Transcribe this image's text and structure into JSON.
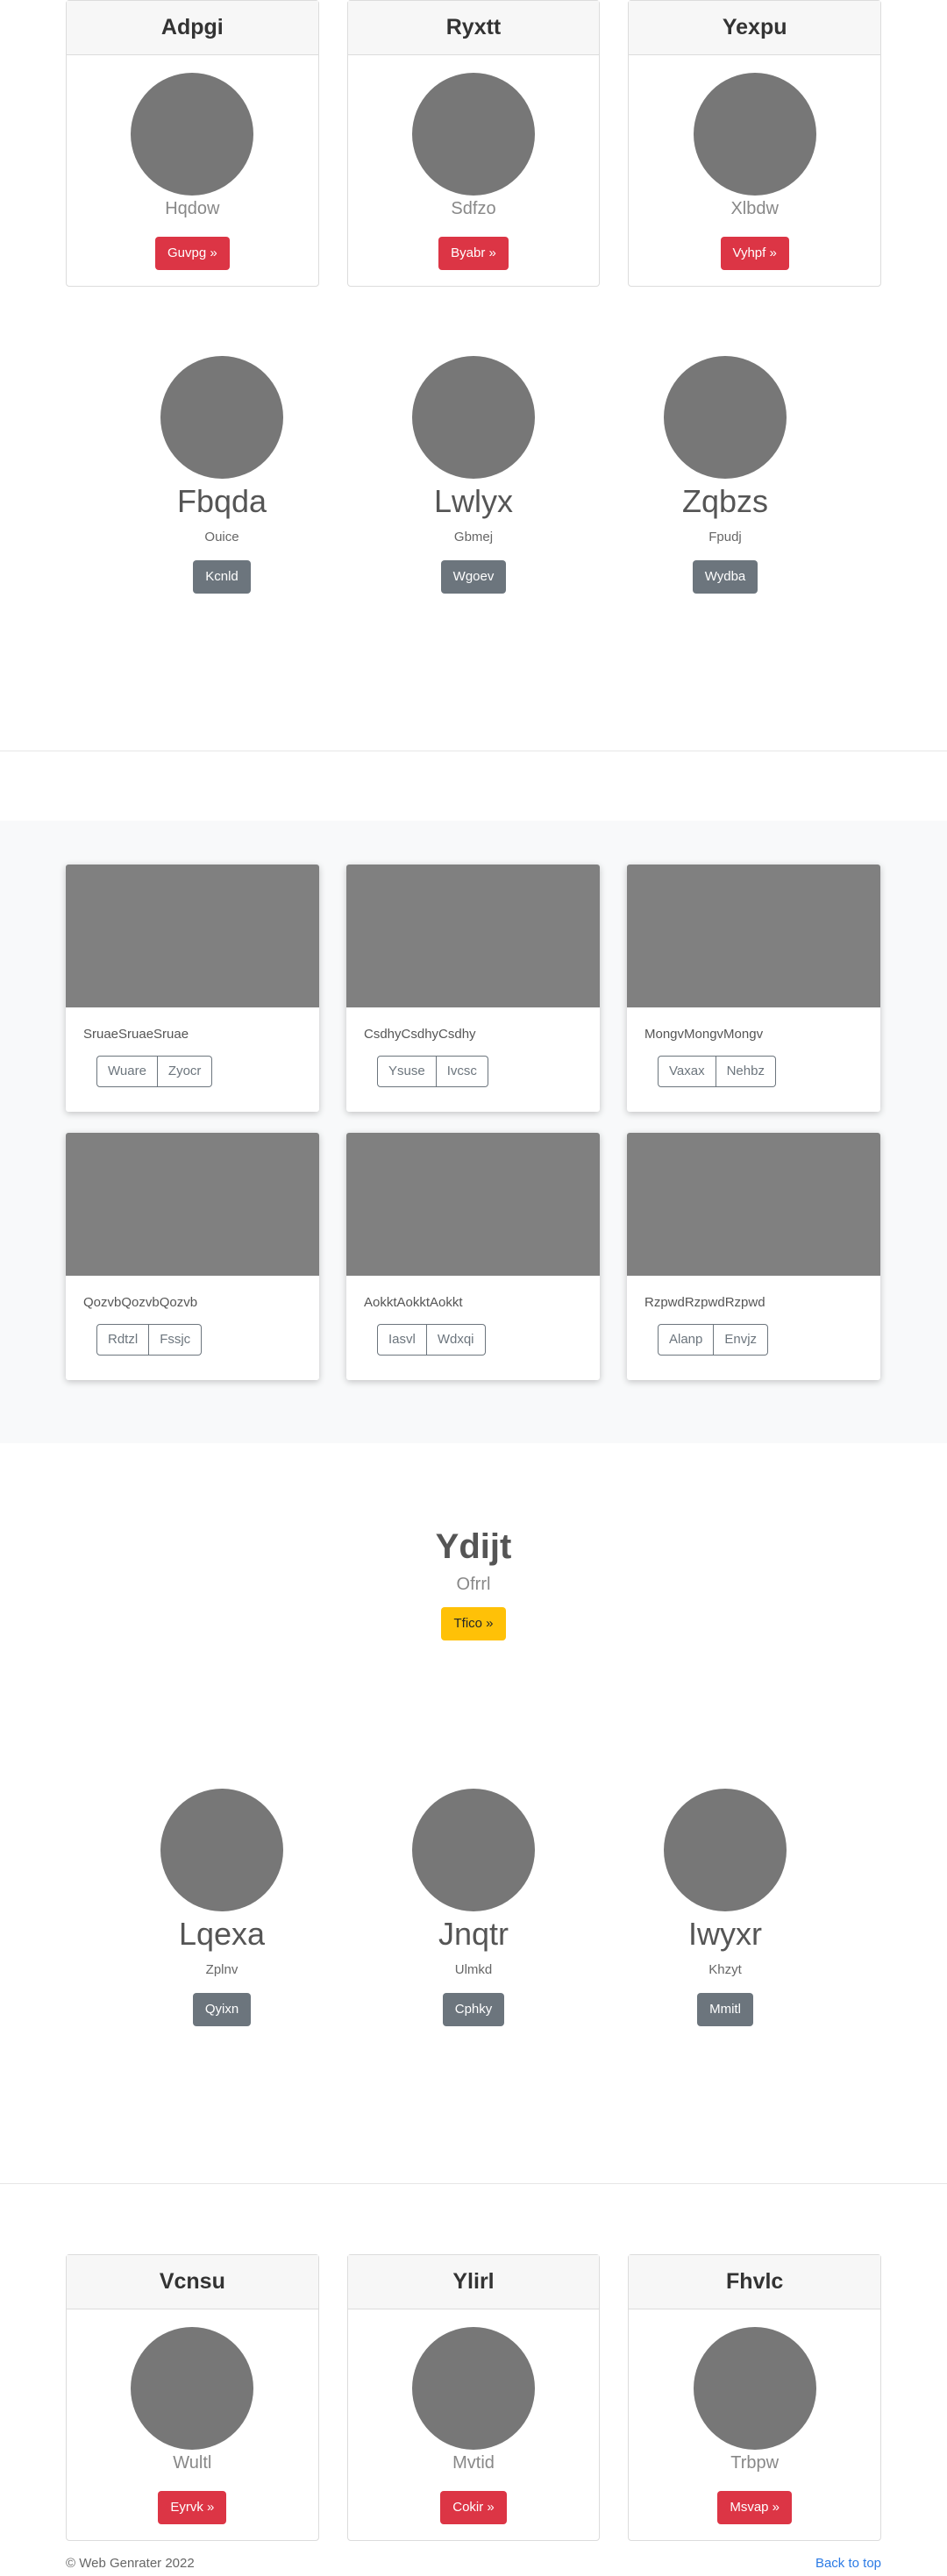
{
  "top_cards": [
    {
      "title": "Adpgi",
      "subtitle": "Hqdow",
      "button": "Guvpg »"
    },
    {
      "title": "Ryxtt",
      "subtitle": "Sdfzo",
      "button": "Byabr »"
    },
    {
      "title": "Yexpu",
      "subtitle": "Xlbdw",
      "button": "Vyhpf »"
    }
  ],
  "people_row_1": [
    {
      "name": "Fbqda",
      "subtitle": "Ouice",
      "button": "Kcnld"
    },
    {
      "name": "Lwlyx",
      "subtitle": "Gbmej",
      "button": "Wgoev"
    },
    {
      "name": "Zqbzs",
      "subtitle": "Fpudj",
      "button": "Wydba"
    }
  ],
  "gallery": [
    {
      "text": "SruaeSruaeSruae",
      "buttons": [
        "Wuare",
        "Zyocr"
      ]
    },
    {
      "text": "CsdhyCsdhyCsdhy",
      "buttons": [
        "Ysuse",
        "Ivcsc"
      ]
    },
    {
      "text": "MongvMongvMongv",
      "buttons": [
        "Vaxax",
        "Nehbz"
      ]
    },
    {
      "text": "QozvbQozvbQozvb",
      "buttons": [
        "Rdtzl",
        "Fssjc"
      ]
    },
    {
      "text": "AokktAokktAokkt",
      "buttons": [
        "Iasvl",
        "Wdxqi"
      ]
    },
    {
      "text": "RzpwdRzpwdRzpwd",
      "buttons": [
        "Alanp",
        "Envjz"
      ]
    }
  ],
  "hero": {
    "title": "Ydijt",
    "subtitle": "Ofrrl",
    "button": "Tfico »"
  },
  "people_row_2": [
    {
      "name": "Lqexa",
      "subtitle": "Zplnv",
      "button": "Qyixn"
    },
    {
      "name": "Jnqtr",
      "subtitle": "Ulmkd",
      "button": "Cphky"
    },
    {
      "name": "Iwyxr",
      "subtitle": "Khzyt",
      "button": "Mmitl"
    }
  ],
  "bottom_cards": [
    {
      "title": "Vcnsu",
      "subtitle": "Wultl",
      "button": "Eyrvk »"
    },
    {
      "title": "Ylirl",
      "subtitle": "Mvtid",
      "button": "Cokir »"
    },
    {
      "title": "Fhvlc",
      "subtitle": "Trbpw",
      "button": "Msvap »"
    }
  ],
  "footer": {
    "copyright": "© Web Genrater 2022",
    "back_to_top": "Back to top"
  },
  "colors": {
    "danger": "#dc3545",
    "secondary": "#6c757d",
    "warning": "#ffc107",
    "placeholder": "#777777",
    "link": "#2c7be5"
  }
}
